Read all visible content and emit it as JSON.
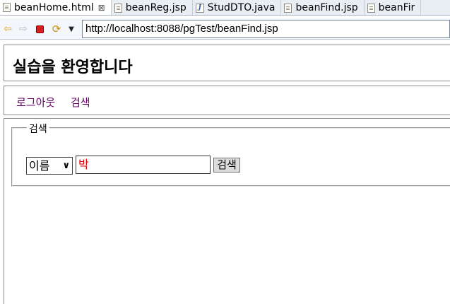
{
  "tabs": [
    {
      "label": "beanHome.html",
      "icon": "file-icon",
      "active": true
    },
    {
      "label": "beanReg.jsp",
      "icon": "file-icon"
    },
    {
      "label": "StudDTO.java",
      "icon": "java-file-icon"
    },
    {
      "label": "beanFind.jsp",
      "icon": "file-icon"
    },
    {
      "label": "beanFir",
      "icon": "file-icon"
    }
  ],
  "tab_close_glyph": "⊠",
  "toolbar": {
    "url": "http://localhost:8088/pgTest/beanFind.jsp"
  },
  "page": {
    "title": "실습을 환영합니다",
    "menu": {
      "logout": "로그아웃",
      "search": "검색"
    },
    "search_form": {
      "legend": "검색",
      "field_select": "이름",
      "query": "박",
      "submit": "검색"
    }
  },
  "colors": {
    "link": "#6b006b",
    "query_text": "#e00000",
    "stop": "#d81e1e"
  }
}
